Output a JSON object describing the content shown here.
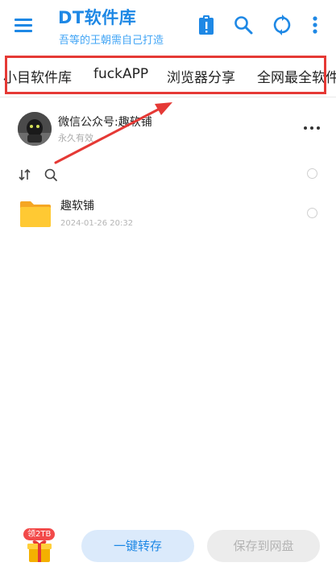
{
  "header": {
    "title": "DT软件库",
    "subtitle": "吾等的王朝需自己打造",
    "icons": [
      "menu-icon",
      "clipboard-alert-icon",
      "search-icon",
      "sync-icon",
      "more-vert-icon"
    ]
  },
  "tabs": [
    {
      "label": "小目软件库"
    },
    {
      "label": "fuckAPP"
    },
    {
      "label": "浏览器分享"
    },
    {
      "label": "全网最全软件"
    }
  ],
  "share": {
    "name": "微信公众号:趣软铺",
    "validity": "永久有效"
  },
  "files": [
    {
      "name": "趣软铺",
      "date": "2024-01-26 20:32",
      "icon": "folder-icon"
    }
  ],
  "bottom": {
    "gift_badge": "领2TB",
    "save_button": "一键转存",
    "disk_button": "保存到网盘"
  },
  "colors": {
    "accent": "#1e88e5",
    "highlight_border": "#e53935",
    "folder": "#ffc107",
    "badge": "#f24a4a"
  }
}
